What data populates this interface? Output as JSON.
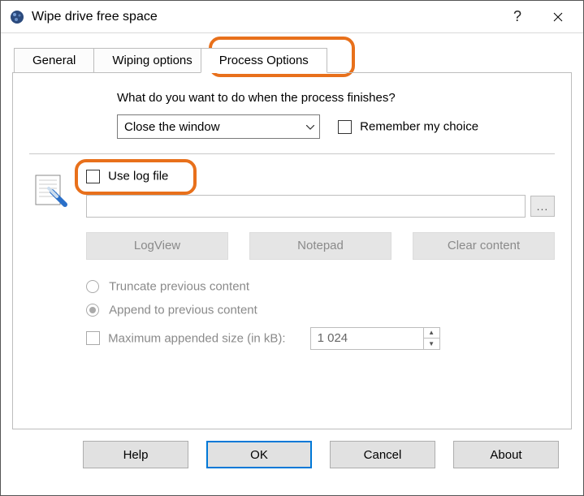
{
  "window": {
    "title": "Wipe drive free space"
  },
  "tabs": {
    "general": "General",
    "wiping": "Wiping options",
    "process": "Process Options"
  },
  "process": {
    "question": "What do you want to do when the process finishes?",
    "finish_action": "Close the window",
    "remember_label": "Remember my choice",
    "use_log_label": "Use log file",
    "log_path": "",
    "browse_label": "...",
    "logview_btn": "LogView",
    "notepad_btn": "Notepad",
    "clear_btn": "Clear content",
    "truncate_label": "Truncate previous content",
    "append_label": "Append to previous content",
    "max_size_label": "Maximum appended size (in kB):",
    "max_size_value": "1 024"
  },
  "footer": {
    "help": "Help",
    "ok": "OK",
    "cancel": "Cancel",
    "about": "About"
  }
}
